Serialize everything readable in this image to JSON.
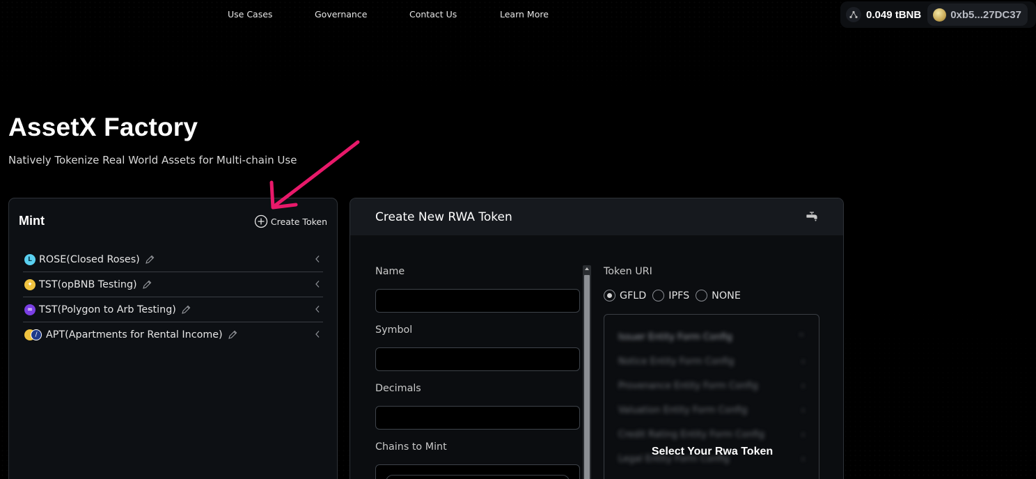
{
  "nav": {
    "items": [
      "Use Cases",
      "Governance",
      "Contact Us",
      "Learn More"
    ]
  },
  "wallet": {
    "balance": "0.049 tBNB",
    "address": "0xb5...27DC37"
  },
  "hero": {
    "title": "AssetX Factory",
    "subtitle": "Natively Tokenize Real World Assets for Multi-chain Use"
  },
  "mint": {
    "heading": "Mint",
    "create_label": "Create Token",
    "tokens": [
      {
        "label": "ROSE(Closed Roses)",
        "icon": "rose-token-icon",
        "color": "#5ad0f0"
      },
      {
        "label": "TST(opBNB Testing)",
        "icon": "bnb-token-icon",
        "color": "#f0c340"
      },
      {
        "label": "TST(Polygon to Arb Testing)",
        "icon": "polygon-token-icon",
        "color": "#7b3fe4"
      },
      {
        "label": "APT(Apartments for Rental Income)",
        "icon": "multichain-token-icon",
        "color": "#f0c340"
      }
    ]
  },
  "form": {
    "title": "Create New RWA Token",
    "fields": {
      "name": "Name",
      "symbol": "Symbol",
      "decimals": "Decimals",
      "chains": "Chains to Mint"
    },
    "token_uri": {
      "label": "Token URI",
      "options": [
        "GFLD",
        "IPFS",
        "NONE"
      ],
      "selected": "GFLD"
    },
    "config_rows": [
      "Issuer Entity Form Config",
      "Notice Entity Form Config",
      "Provenance Entity Form Config",
      "Valuation Entity Form Config",
      "Credit Rating Entity Form Config",
      "Legal Entity Form Config"
    ],
    "select_message": "Select Your Rwa Token"
  },
  "colors": {
    "accent_arrow": "#e8196a"
  }
}
